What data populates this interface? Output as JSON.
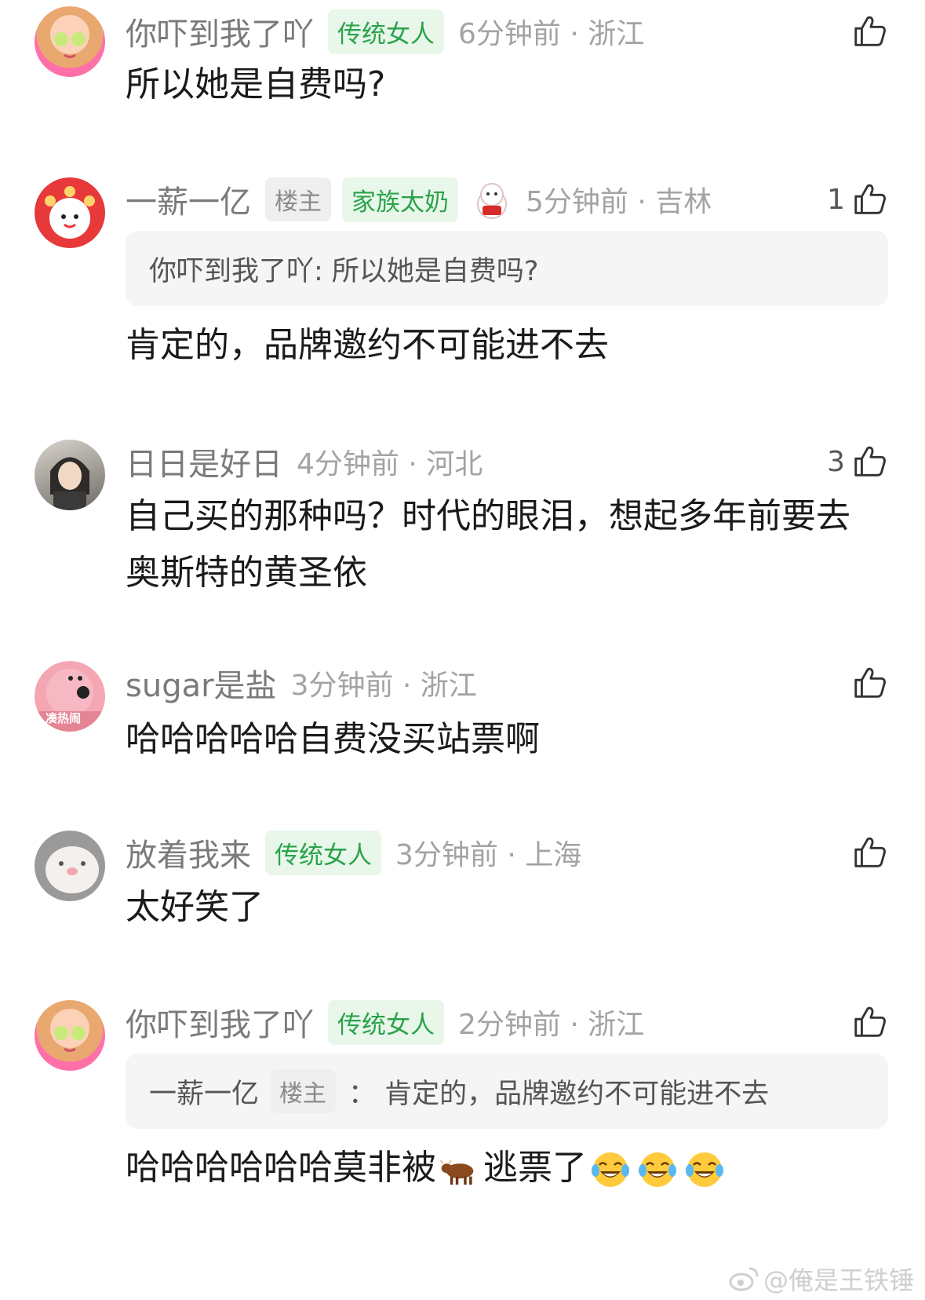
{
  "comments": [
    {
      "name": "你吓到我了吖",
      "badge": "传统女人",
      "time": "6分钟前 · 浙江",
      "text": "所以她是自费吗?",
      "likes": ""
    },
    {
      "name": "一薪一亿",
      "op_badge": "楼主",
      "badge": "家族太奶",
      "time": "5分钟前 · 吉林",
      "quote": "你吓到我了吖:  所以她是自费吗?",
      "text": "肯定的，品牌邀约不可能进不去",
      "likes": "1"
    },
    {
      "name": "日日是好日",
      "time": "4分钟前 · 河北",
      "text": "自己买的那种吗？时代的眼泪，想起多年前要去奥斯特的黄圣依",
      "likes": "3"
    },
    {
      "name": "sugar是盐",
      "time": "3分钟前 · 浙江",
      "avatar_tag": "凑热闹",
      "text": "哈哈哈哈哈自费没买站票啊",
      "likes": ""
    },
    {
      "name": "放着我来",
      "badge": "传统女人",
      "time": "3分钟前 · 上海",
      "text": "太好笑了",
      "likes": ""
    },
    {
      "name": "你吓到我了吖",
      "badge": "传统女人",
      "time": "2分钟前 · 浙江",
      "quote_name": "一薪一亿",
      "quote_badge": "楼主",
      "quote_text": "：  肯定的，品牌邀约不可能进不去",
      "text_a": "哈哈哈哈哈哈莫非被",
      "text_b": "逃票了",
      "likes": ""
    }
  ],
  "watermark": "@俺是王铁锤",
  "icons": {
    "like": "thumbs-up-icon",
    "cow": "cow-emoji-icon",
    "laugh": "tears-of-joy-emoji-icon",
    "watermark_logo": "weibo-logo-icon"
  },
  "colors": {
    "badge_green": "#2aa34a",
    "badge_green_bg": "#e8f7ea",
    "meta_gray": "#a3a3a3"
  }
}
